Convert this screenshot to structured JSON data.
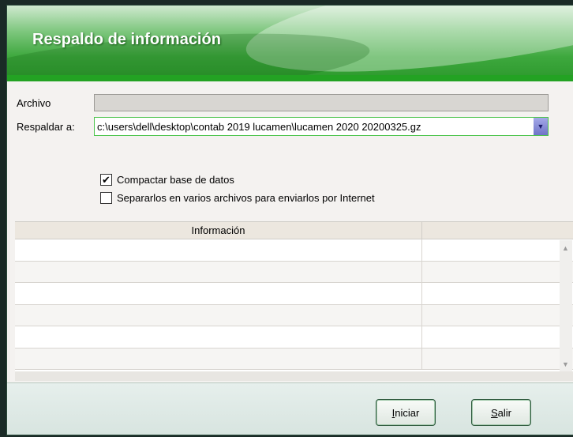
{
  "window": {
    "title": "Respaldo de información"
  },
  "form": {
    "archivo_label": "Archivo",
    "archivo_value": "",
    "respaldar_label": "Respaldar a:",
    "respaldar_value": "c:\\users\\dell\\desktop\\contab 2019 lucamen\\lucamen 2020 20200325.gz"
  },
  "options": {
    "compactar": {
      "label": "Compactar base de datos",
      "checked": true
    },
    "separar": {
      "label": "Separarlos en varios archivos para enviarlos por Internet",
      "checked": false
    }
  },
  "grid": {
    "columns": [
      "Información",
      ""
    ],
    "rows": [
      [
        "",
        ""
      ],
      [
        "",
        ""
      ],
      [
        "",
        ""
      ],
      [
        "",
        ""
      ],
      [
        "",
        ""
      ],
      [
        "",
        ""
      ]
    ]
  },
  "buttons": {
    "iniciar": {
      "mnemonic": "I",
      "rest": "niciar"
    },
    "salir": {
      "mnemonic": "S",
      "rest": "alir"
    }
  },
  "icons": {
    "dropdown": "chevron-down-icon",
    "check": "checkmark-icon"
  },
  "colors": {
    "accent": "#2e9a2e",
    "header_bar": "#23a223"
  }
}
